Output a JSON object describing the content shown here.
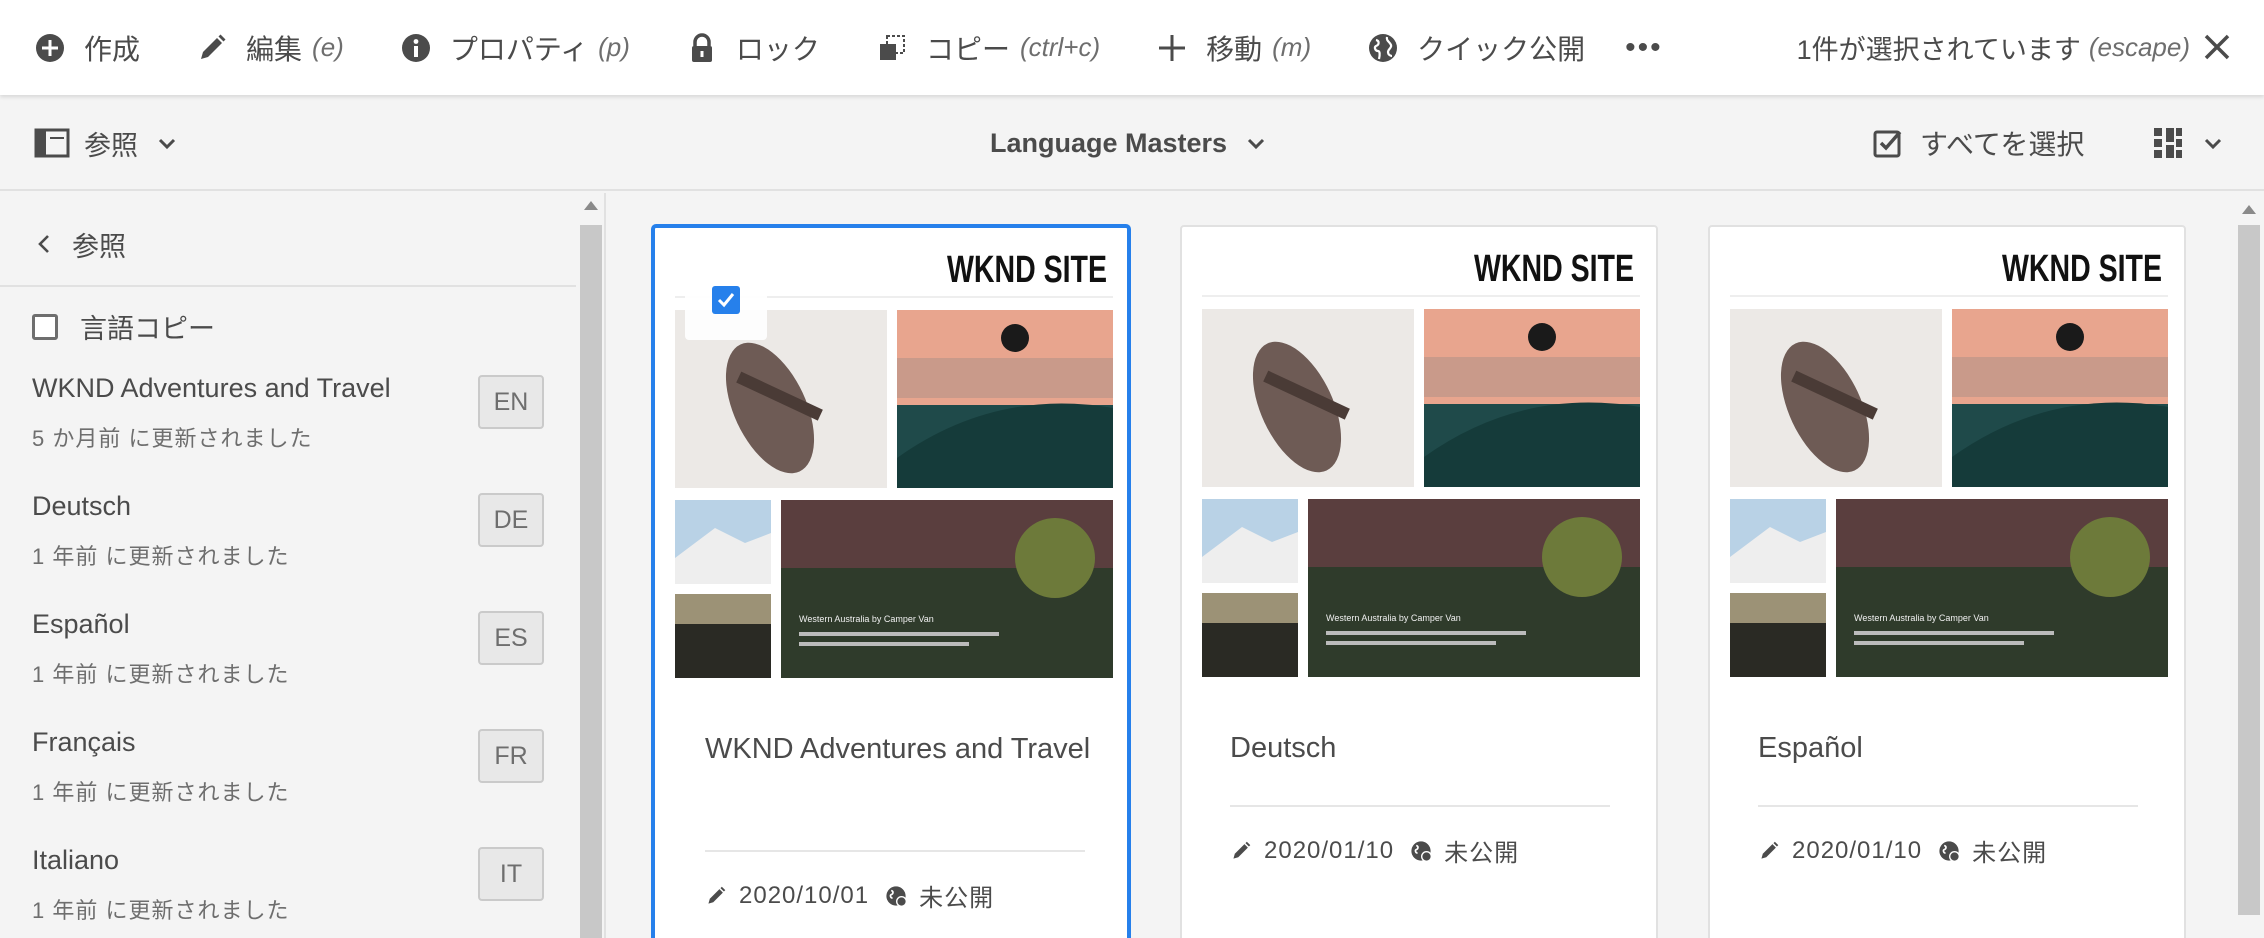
{
  "actionbar": {
    "create": {
      "label": "作成",
      "icon": "add-circle-icon"
    },
    "edit": {
      "label": "編集",
      "hint": "(e)",
      "icon": "pencil-icon"
    },
    "properties": {
      "label": "プロパティ",
      "hint": "(p)",
      "icon": "info-icon"
    },
    "lock": {
      "label": "ロック",
      "icon": "lock-icon"
    },
    "copy": {
      "label": "コピー",
      "hint": "(ctrl+c)",
      "icon": "copy-icon"
    },
    "move": {
      "label": "移動",
      "hint": "(m)",
      "icon": "move-icon"
    },
    "quick_publish": {
      "label": "クイック公開",
      "icon": "globe-icon"
    },
    "more": "•••",
    "selection_status": "1件が選択されています",
    "selection_hint": "(escape)"
  },
  "toolbar": {
    "rail_toggle_label": "参照",
    "title": "Language Masters",
    "select_all_label": "すべてを選択"
  },
  "rail": {
    "back_label": "参照",
    "language_copy_label": "言語コピー",
    "items": [
      {
        "name": "WKND Adventures and Travel",
        "meta": "5 か月前 に更新されました",
        "tag": "EN"
      },
      {
        "name": "Deutsch",
        "meta": "1 年前 に更新されました",
        "tag": "DE"
      },
      {
        "name": "Español",
        "meta": "1 年前 に更新されました",
        "tag": "ES"
      },
      {
        "name": "Français",
        "meta": "1 年前 に更新されました",
        "tag": "FR"
      },
      {
        "name": "Italiano",
        "meta": "1 年前 に更新されました",
        "tag": "IT"
      }
    ]
  },
  "cards": [
    {
      "title": "WKND Adventures and Travel",
      "date": "2020/10/01",
      "status": "未公開",
      "selected": true,
      "site_label": "WKND SITE",
      "thumb_caption": "Western Australia by Camper Van"
    },
    {
      "title": "Deutsch",
      "date": "2020/01/10",
      "status": "未公開",
      "selected": false,
      "site_label": "WKND SITE",
      "thumb_caption": "Western Australia by Camper Van"
    },
    {
      "title": "Español",
      "date": "2020/01/10",
      "status": "未公開",
      "selected": false,
      "site_label": "WKND SITE",
      "thumb_caption": "Western Australia by Camper Van"
    }
  ],
  "colors": {
    "accent": "#2680eb",
    "text": "#4b4b4b",
    "background": "#f4f4f4"
  }
}
